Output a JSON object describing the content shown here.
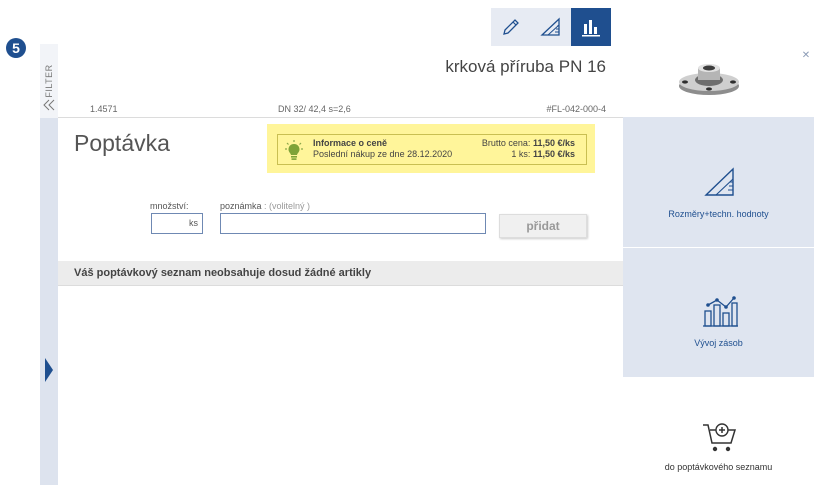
{
  "step": {
    "number": "5"
  },
  "filter": {
    "label": "FILTER"
  },
  "product": {
    "name": "krková příruba PN 16",
    "material": "1.4571",
    "dimensions": "DN 32/ 42,4 s=2,6",
    "code": "#FL-042-000-4"
  },
  "page": {
    "title": "Poptávka"
  },
  "price": {
    "title": "Informace o ceně",
    "last_purchase": "Poslední nákup ze dne 28.12.2020",
    "brutto_label": "Brutto cena:",
    "brutto_value": "11,50 €/ks",
    "ks_label": "1 ks:",
    "ks_value": "11,50 €/ks"
  },
  "form": {
    "qty_label": "množství:",
    "qty_unit": "ks",
    "note_label": "poznámka",
    "note_optional": " : (volitelný )",
    "add_label": "přidat"
  },
  "list": {
    "empty_message": "Váš poptávkový seznam neobsahuje dosud žádné artikly"
  },
  "sidebar": {
    "dims_label": "Rozměry+techn. hodnoty",
    "stock_label": "Vývoj zásob",
    "cart_label": "do poptávkového seznamu"
  },
  "colors": {
    "accent": "#1f4f8f",
    "panel": "#dfe5f0",
    "price_highlight": "#fff59a"
  },
  "icons": [
    "pencil-icon",
    "ruler-triangle-icon",
    "bar-chart-icon",
    "bulb-icon",
    "stock-chart-icon",
    "cart-plus-icon",
    "close-icon",
    "chevron-double-left-icon"
  ]
}
